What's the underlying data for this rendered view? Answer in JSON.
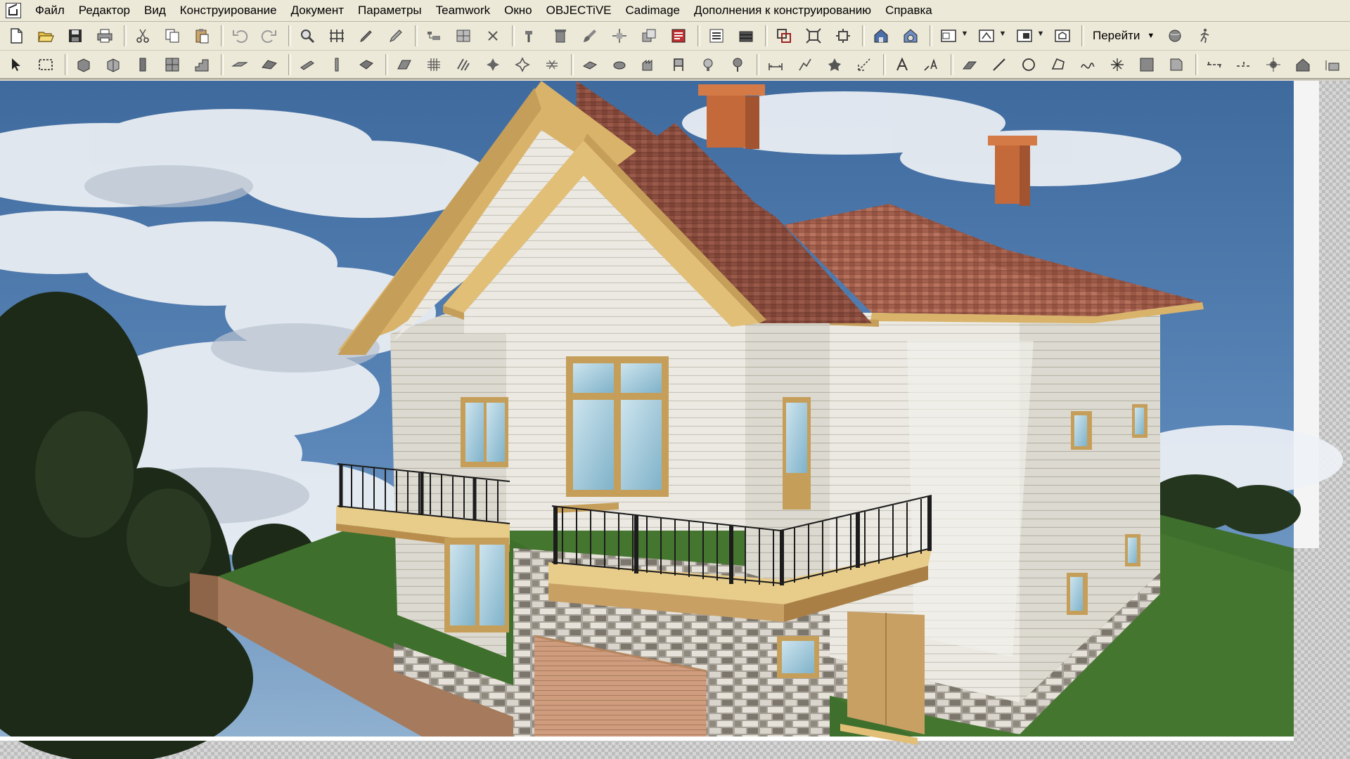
{
  "menu": {
    "items": [
      "Файл",
      "Редактор",
      "Вид",
      "Конструирование",
      "Документ",
      "Параметры",
      "Teamwork",
      "Окно",
      "OBJECTiVE",
      "Cadimage",
      "Дополнения к конструированию",
      "Справка"
    ]
  },
  "toolbar": {
    "goto_label": "Перейти"
  },
  "viewport": {
    "mode": "3d-render"
  },
  "colors": {
    "ui_bg": "#ece9d8",
    "sky": "#4c77a8",
    "roof": "#8a4c3e",
    "trim": "#d9b36a",
    "siding": "#e9e7df",
    "grass": "#41712e"
  }
}
